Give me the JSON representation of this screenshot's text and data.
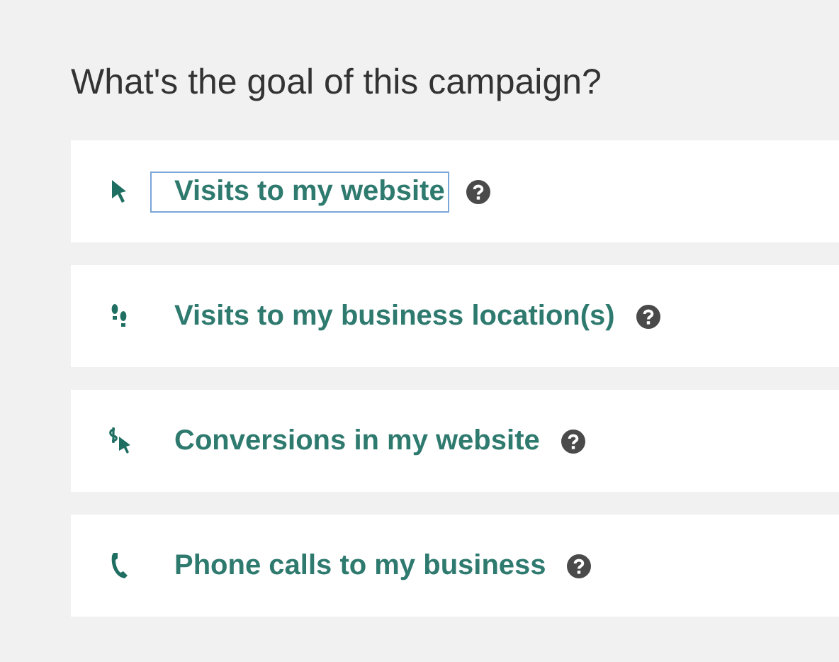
{
  "title": "What's the goal of this campaign?",
  "goals": [
    {
      "kind": "website",
      "label": "Visits to my website",
      "selected": true
    },
    {
      "kind": "location",
      "label": "Visits to my business location(s)",
      "selected": false
    },
    {
      "kind": "conversion",
      "label": "Conversions in my website",
      "selected": false
    },
    {
      "kind": "phone",
      "label": "Phone calls to my business",
      "selected": false
    }
  ]
}
